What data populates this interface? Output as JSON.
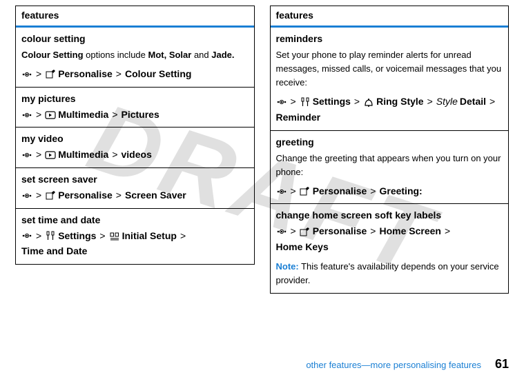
{
  "watermark": "DRAFT",
  "left": {
    "header": "features",
    "rows": [
      {
        "title": "colour setting",
        "desc_pre": "Colour Setting",
        "desc_mid": " options include ",
        "desc_b1": "Mot, Solar",
        "desc_mid2": " and ",
        "desc_b2": "Jade.",
        "path": [
          "menu-icon",
          ">",
          "personalise-icon",
          "Personalise",
          ">",
          "Colour Setting"
        ]
      },
      {
        "title": "my pictures",
        "path": [
          "menu-icon",
          ">",
          "multimedia-icon",
          "Multimedia",
          ">",
          "Pictures"
        ]
      },
      {
        "title": "my video",
        "path": [
          "menu-icon",
          ">",
          "multimedia-icon",
          "Multimedia",
          ">",
          "videos"
        ]
      },
      {
        "title": "set screen saver",
        "path": [
          "menu-icon",
          ">",
          "personalise-icon",
          "Personalise",
          ">",
          "Screen Saver"
        ]
      },
      {
        "title": "set time and date",
        "path": [
          "menu-icon",
          ">",
          "settings-icon",
          "Settings",
          ">",
          "initial-setup-icon",
          "Initial Setup",
          ">",
          "Time and Date"
        ]
      }
    ]
  },
  "right": {
    "header": "features",
    "rows": [
      {
        "title": "reminders",
        "desc": "Set your phone to play reminder alerts for unread messages, missed calls, or voicemail messages that you receive:",
        "path": [
          "menu-icon",
          ">",
          "settings-icon",
          "Settings",
          ">",
          "ring-icon",
          "Ring Style",
          ">",
          "Style",
          "Detail",
          ">",
          "Reminder"
        ],
        "italic_index": 8
      },
      {
        "title": "greeting",
        "desc": "Change the greeting that appears when you turn on your phone:",
        "path": [
          "menu-icon",
          ">",
          "personalise-icon",
          "Personalise",
          ">",
          "Greeting:"
        ]
      },
      {
        "title": "change home screen soft key labels",
        "path": [
          "menu-icon",
          ">",
          "personalise-icon",
          "Personalise",
          ">",
          "Home Screen",
          ">",
          "Home Keys"
        ],
        "note_label": "Note:",
        "note_text": " This feature's availability depends on your service provider."
      }
    ]
  },
  "footer": {
    "title": "other features—more personalising features",
    "page": "61"
  }
}
